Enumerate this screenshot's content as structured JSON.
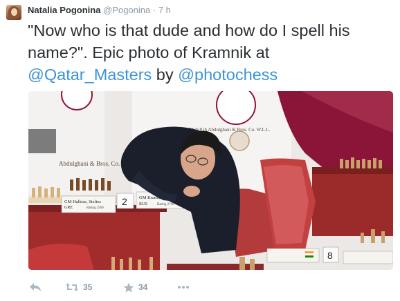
{
  "tweet": {
    "author_name": "Natalia Pogonina",
    "author_handle": "@Pogonina",
    "separator": "·",
    "time": "7 h",
    "text_part1": "\"Now who is that dude and how do I spell his name?\". Epic photo of Kramnik at ",
    "mention1": "@Qatar_Masters",
    "text_part2": " by ",
    "mention2": "@photochess"
  },
  "photo": {
    "sign_left": "GM Halkias, Stelios",
    "sign_left_country": "GRE",
    "sign_left_rating": "Rating 2569",
    "sign_right": "GM Kramnik, Vladimir",
    "sign_right_country": "RUS",
    "sign_right_rating": "Rating 2760",
    "board_number": "2",
    "board_number_right": "8",
    "sponsor_text": "Abdullah Abdulghani & Bros. Co. W.L.L.",
    "sponsor_text_left": "Abdulghani & Bros. Co. W.L.L."
  },
  "actions": {
    "reply_icon": "reply-icon",
    "retweet_icon": "retweet-icon",
    "retweet_count": "35",
    "favorite_icon": "star-icon",
    "favorite_count": "34",
    "more_icon": "more-icon"
  },
  "colors": {
    "link": "#3b94d9",
    "meta": "#8899a6",
    "text": "#292f33",
    "qatar_maroon": "#8a1538"
  }
}
